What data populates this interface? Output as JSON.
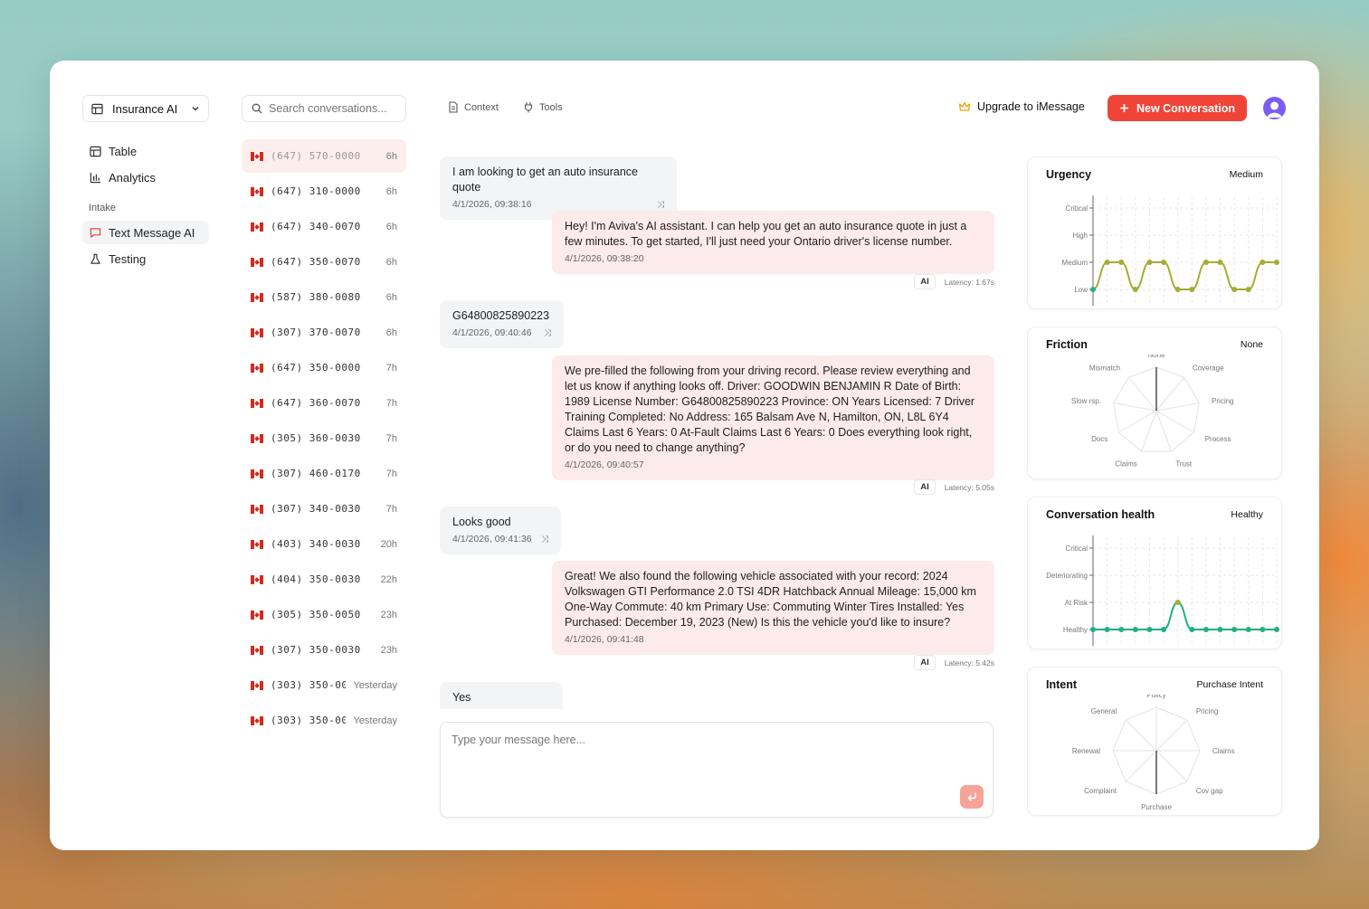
{
  "sidebar": {
    "app_name": "Insurance AI",
    "nav": [
      {
        "label": "Table",
        "icon": "table-icon"
      },
      {
        "label": "Analytics",
        "icon": "bar-chart-icon"
      }
    ],
    "section_label": "Intake",
    "intake": [
      {
        "label": "Text Message AI",
        "icon": "message-icon",
        "active": true
      },
      {
        "label": "Testing",
        "icon": "flask-icon"
      }
    ]
  },
  "conversations": {
    "search_placeholder": "Search conversations...",
    "items": [
      {
        "phone": "(647) 570-0000",
        "time": "6h",
        "active": true
      },
      {
        "phone": "(647) 310-0000",
        "time": "6h"
      },
      {
        "phone": "(647) 340-0070",
        "time": "6h"
      },
      {
        "phone": "(647) 350-0070",
        "time": "6h"
      },
      {
        "phone": "(587) 380-0080",
        "time": "6h"
      },
      {
        "phone": "(307) 370-0070",
        "time": "6h"
      },
      {
        "phone": "(647) 350-0000",
        "time": "7h"
      },
      {
        "phone": "(647) 360-0070",
        "time": "7h"
      },
      {
        "phone": "(305) 360-0030",
        "time": "7h"
      },
      {
        "phone": "(307) 460-0170",
        "time": "7h"
      },
      {
        "phone": "(307) 340-0030",
        "time": "7h"
      },
      {
        "phone": "(403) 340-0030",
        "time": "20h"
      },
      {
        "phone": "(404) 350-0030",
        "time": "22h"
      },
      {
        "phone": "(305) 350-0050",
        "time": "23h"
      },
      {
        "phone": "(307) 350-0030",
        "time": "23h"
      },
      {
        "phone": "(303) 350-00",
        "time": "Yesterday"
      },
      {
        "phone": "(303) 350-00",
        "time": "Yesterday"
      }
    ]
  },
  "toolbar": {
    "context_label": "Context",
    "tools_label": "Tools",
    "upgrade_label": "Upgrade to iMessage",
    "new_conversation_label": "New Conversation"
  },
  "chat": {
    "messages": [
      {
        "role": "user",
        "text": "I am looking to get an auto insurance quote",
        "ts": "4/1/2026, 09:38:16"
      },
      {
        "role": "ai",
        "text": "Hey! I'm Aviva's AI assistant. I can help you get an auto insurance quote in just a few minutes. To get started, I'll just need your Ontario driver's license number.",
        "ts": "4/1/2026, 09:38:20",
        "tag": "AI",
        "latency": "Latency: 1.67s"
      },
      {
        "role": "user",
        "text": "G64800825890223",
        "ts": "4/1/2026, 09:40:46"
      },
      {
        "role": "ai",
        "text": "We pre-filled the following from your driving record. Please review everything and let us know if anything looks off. Driver: GOODWIN BENJAMIN R Date of Birth: 1989 License Number: G64800825890223 Province: ON Years Licensed: 7 Driver Training Completed: No Address: 165 Balsam Ave N, Hamilton, ON, L8L 6Y4 Claims Last 6 Years: 0 At-Fault Claims Last 6 Years: 0 Does everything look right, or do you need to change anything?",
        "ts": "4/1/2026, 09:40:57",
        "tag": "AI",
        "latency": "Latency: 5.05s"
      },
      {
        "role": "user",
        "text": "Looks good",
        "ts": "4/1/2026, 09:41:36"
      },
      {
        "role": "ai",
        "text": "Great! We also found the following vehicle associated with your record: 2024 Volkswagen GTI Performance 2.0 TSI 4DR Hatchback Annual Mileage: 15,000 km One-Way Commute: 40 km Primary Use: Commuting Winter Tires Installed: Yes Purchased: December 19, 2023 (New) Is this the vehicle you'd like to insure?",
        "ts": "4/1/2026, 09:41:48",
        "tag": "AI",
        "latency": "Latency: 5.42s"
      },
      {
        "role": "user",
        "text": "Yes",
        "ts": ""
      }
    ],
    "composer_placeholder": "Type your message here..."
  },
  "metrics": {
    "urgency": {
      "title": "Urgency",
      "value": "Medium",
      "levels": [
        "Low",
        "Medium",
        "High",
        "Critical"
      ],
      "series": [
        0,
        1,
        1,
        0,
        1,
        1,
        0,
        0,
        1,
        1,
        0,
        0,
        1,
        1
      ],
      "line_color": "#a3ad35",
      "marker_low_color": "#22b07d",
      "marker_color": "#a3ad35"
    },
    "friction": {
      "title": "Friction",
      "value": "None",
      "axes": [
        "None",
        "Coverage",
        "Pricing",
        "Process",
        "Trust",
        "Claims",
        "Docs",
        "Slow rsp.",
        "Mismatch"
      ],
      "values": [
        1,
        0,
        0,
        0,
        0,
        0,
        0,
        0,
        0
      ]
    },
    "health": {
      "title": "Conversation health",
      "value": "Healthy",
      "levels": [
        "Healthy",
        "At Risk",
        "Deteriorating",
        "Critical"
      ],
      "series": [
        0,
        0,
        0,
        0,
        0,
        0,
        1,
        0,
        0,
        0,
        0,
        0,
        0,
        0
      ],
      "line_color": "#22b07d",
      "marker_color": "#22b07d",
      "marker_high_color": "#a3ad35"
    },
    "intent": {
      "title": "Intent",
      "value": "Purchase Intent",
      "axes": [
        "Policy",
        "Pricing",
        "Claims",
        "Cov gap",
        "Purchase",
        "Complaint",
        "Renewal",
        "General"
      ],
      "values": [
        0,
        0,
        0,
        0,
        1,
        0,
        0,
        0
      ]
    }
  }
}
